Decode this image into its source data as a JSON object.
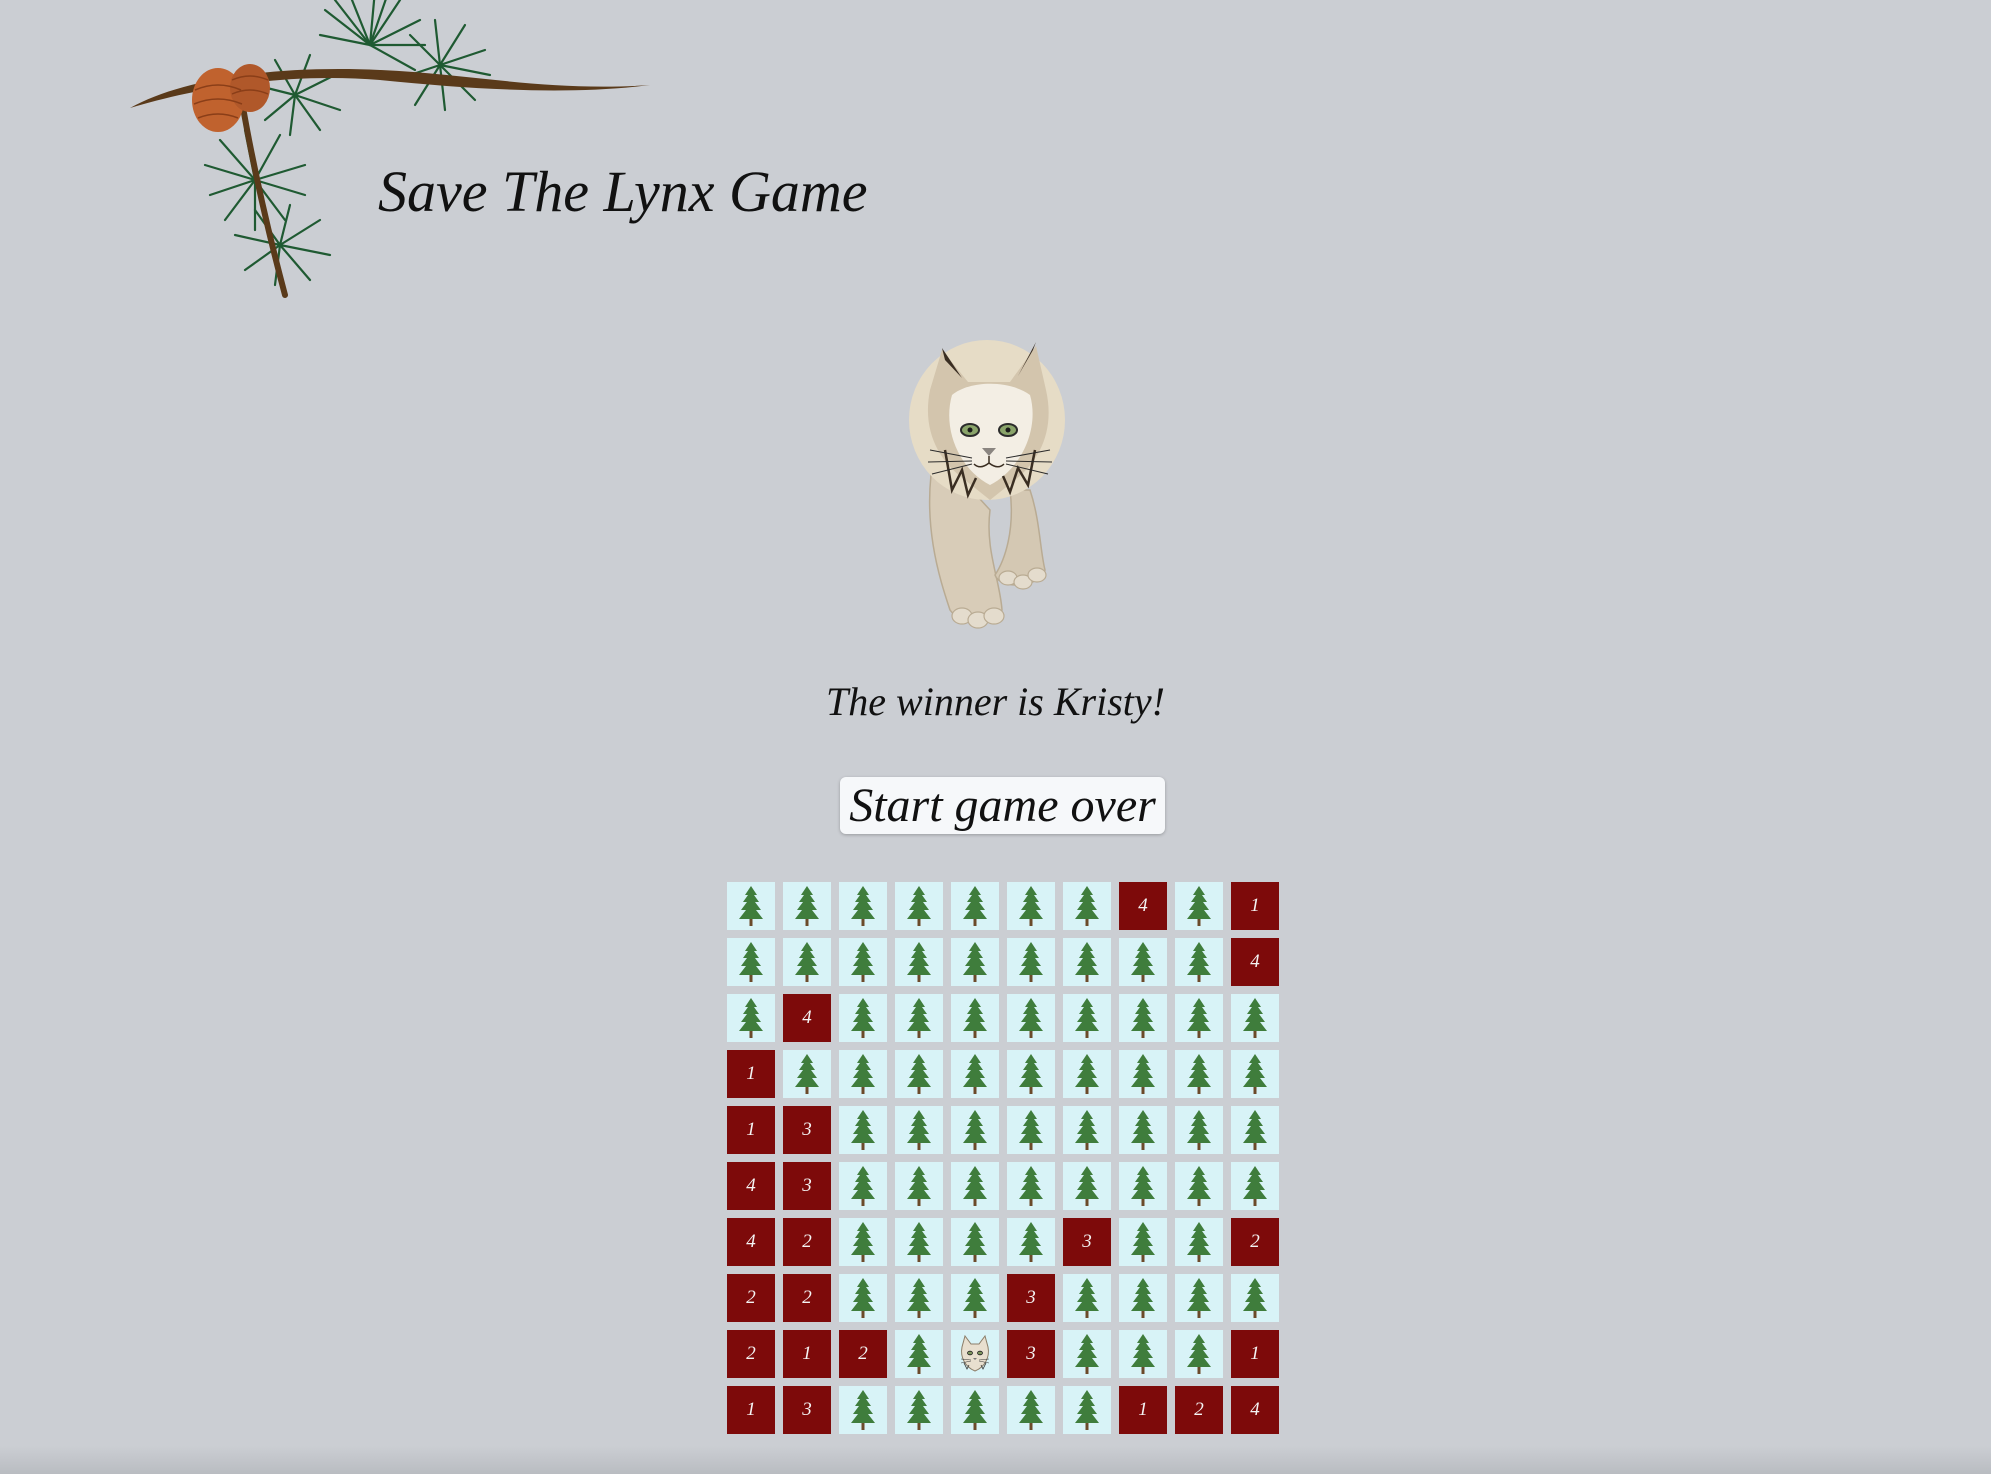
{
  "page": {
    "title": "Save The Lynx Game",
    "winner_message": "The winner is Kristy!",
    "restart_label": "Start game over"
  },
  "icons": {
    "header_decoration": "pine-branch-icon",
    "hero": "lynx-icon",
    "hidden_cell": "pine-tree-icon",
    "found_cell": "lynx-face-icon"
  },
  "colors": {
    "background": "#cbced3",
    "hidden_cell": "#d8f3f7",
    "revealed_cell": "#7d0a0a",
    "tree": "#3f7d3c"
  },
  "board": {
    "rows": 10,
    "cols": 10,
    "cells": [
      [
        "T",
        "T",
        "T",
        "T",
        "T",
        "T",
        "T",
        "4",
        "T",
        "1"
      ],
      [
        "T",
        "T",
        "T",
        "T",
        "T",
        "T",
        "T",
        "T",
        "T",
        "4"
      ],
      [
        "T",
        "4",
        "T",
        "T",
        "T",
        "T",
        "T",
        "T",
        "T",
        "T"
      ],
      [
        "1",
        "T",
        "T",
        "T",
        "T",
        "T",
        "T",
        "T",
        "T",
        "T"
      ],
      [
        "1",
        "3",
        "T",
        "T",
        "T",
        "T",
        "T",
        "T",
        "T",
        "T"
      ],
      [
        "4",
        "3",
        "T",
        "T",
        "T",
        "T",
        "T",
        "T",
        "T",
        "T"
      ],
      [
        "4",
        "2",
        "T",
        "T",
        "T",
        "T",
        "3",
        "T",
        "T",
        "2"
      ],
      [
        "2",
        "2",
        "T",
        "T",
        "T",
        "3",
        "T",
        "T",
        "T",
        "T"
      ],
      [
        "2",
        "1",
        "2",
        "T",
        "L",
        "3",
        "T",
        "T",
        "T",
        "1"
      ],
      [
        "1",
        "3",
        "T",
        "T",
        "T",
        "T",
        "T",
        "1",
        "2",
        "4"
      ]
    ]
  }
}
